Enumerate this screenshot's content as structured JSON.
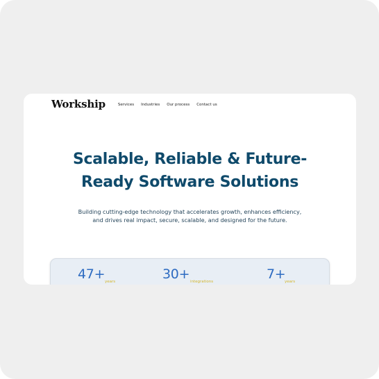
{
  "brand": {
    "logo": "Workship"
  },
  "nav": {
    "items": [
      {
        "label": "Services"
      },
      {
        "label": "Industries"
      },
      {
        "label": "Our process"
      },
      {
        "label": "Contact us"
      }
    ]
  },
  "hero": {
    "title_line1": "Scalable, Reliable & Future-",
    "title_line2": "Ready Software Solutions",
    "subtitle_line1": "Building cutting-edge technology that accelerates growth, enhances efficiency,",
    "subtitle_line2": "and drives real impact, secure, scalable, and designed for the future."
  },
  "stats": [
    {
      "value": "47+",
      "label": "years"
    },
    {
      "value": "30+",
      "label": "integrations"
    },
    {
      "value": "7+",
      "label": "years"
    }
  ],
  "colors": {
    "heading": "#0f4a6b",
    "stat_value": "#2d6bc1",
    "stat_label": "#d4b52a",
    "outer_background": "#efefef"
  }
}
